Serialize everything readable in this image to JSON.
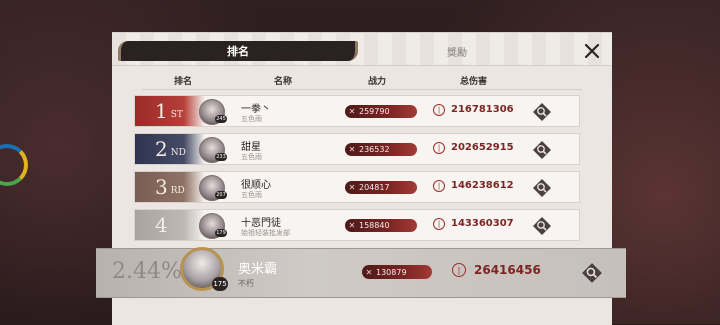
{
  "tabs": {
    "active": "排名",
    "inactive": "獎勵"
  },
  "headers": {
    "rank": "排名",
    "name": "名称",
    "power": "战力",
    "damage": "总伤害"
  },
  "rows": [
    {
      "rank_num": "1",
      "rank_suffix": "ST",
      "level": "245",
      "name": "一拳丶",
      "guild": "五色雨",
      "power": "259790",
      "damage": "216781306",
      "badge_color": "#9b2a27"
    },
    {
      "rank_num": "2",
      "rank_suffix": "ND",
      "level": "233",
      "name": "甜星",
      "guild": "五色雨",
      "power": "236532",
      "damage": "202652915",
      "badge_color": "#2f3550"
    },
    {
      "rank_num": "3",
      "rank_suffix": "RD",
      "level": "207",
      "name": "很顺心",
      "guild": "五色雨",
      "power": "204817",
      "damage": "146238612",
      "badge_color": "#7a5d52"
    },
    {
      "rank_num": "4",
      "rank_suffix": "",
      "level": "179",
      "name": "十恶門徒",
      "guild": "始祖轻装批发部",
      "power": "158840",
      "damage": "143360307",
      "badge_color": "#a9a4a0"
    }
  ],
  "self": {
    "percent": "2.44%",
    "level": "175",
    "name": "奥米霸",
    "guild": "不朽",
    "power": "130879",
    "damage": "26416456"
  },
  "icons": {
    "close": "close-icon",
    "sword": "sword-icon",
    "damage": "damage-icon",
    "inspect": "inspect-icon"
  }
}
